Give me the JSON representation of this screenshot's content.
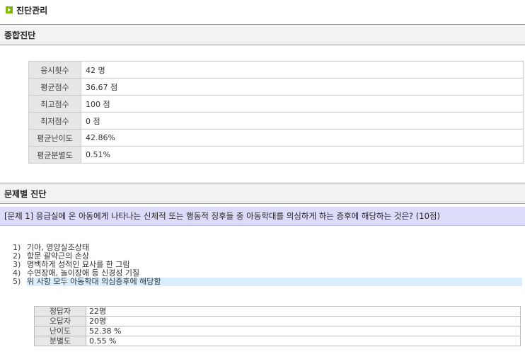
{
  "page": {
    "title": "진단관리"
  },
  "summary": {
    "heading": "종합진단",
    "rows": [
      {
        "label": "응시횟수",
        "value": "42 명"
      },
      {
        "label": "평균점수",
        "value": "36.67 점"
      },
      {
        "label": "최고점수",
        "value": "100 점"
      },
      {
        "label": "최저점수",
        "value": "0 점"
      },
      {
        "label": "평균난이도",
        "value": "42.86%"
      },
      {
        "label": "평균분별도",
        "value": "0.51%"
      }
    ]
  },
  "question_section": {
    "heading": "문제별 진단",
    "question": "[문제 1] 응급실에 온 아동에게 나타나는 신체적 또는 행동적 징후들 중 아동학대를 의심하게 하는 증후에 해당하는 것은? (10점)",
    "options": [
      {
        "num": "1)",
        "text": "기아, 영양실조상태",
        "correct": false
      },
      {
        "num": "2)",
        "text": "항문 괄약근의 손상",
        "correct": false
      },
      {
        "num": "3)",
        "text": "명백하게 성적인 묘사를 한 그림",
        "correct": false
      },
      {
        "num": "4)",
        "text": "수면장애, 놀이장애 등 신경성 기질",
        "correct": false
      },
      {
        "num": "5)",
        "text": "위 사항 모두 아동학대 의심증후에 해당함",
        "correct": true
      }
    ],
    "stats": [
      {
        "label": "정답자",
        "value": "22명"
      },
      {
        "label": "오답자",
        "value": "20명"
      },
      {
        "label": "난이도",
        "value": "52.38 %"
      },
      {
        "label": "분별도",
        "value": "0.55 %"
      }
    ]
  },
  "colors": {
    "title_icon": "#7cb800",
    "question_bar": "#dcdcfa",
    "correct_highlight": "#d9efff"
  }
}
